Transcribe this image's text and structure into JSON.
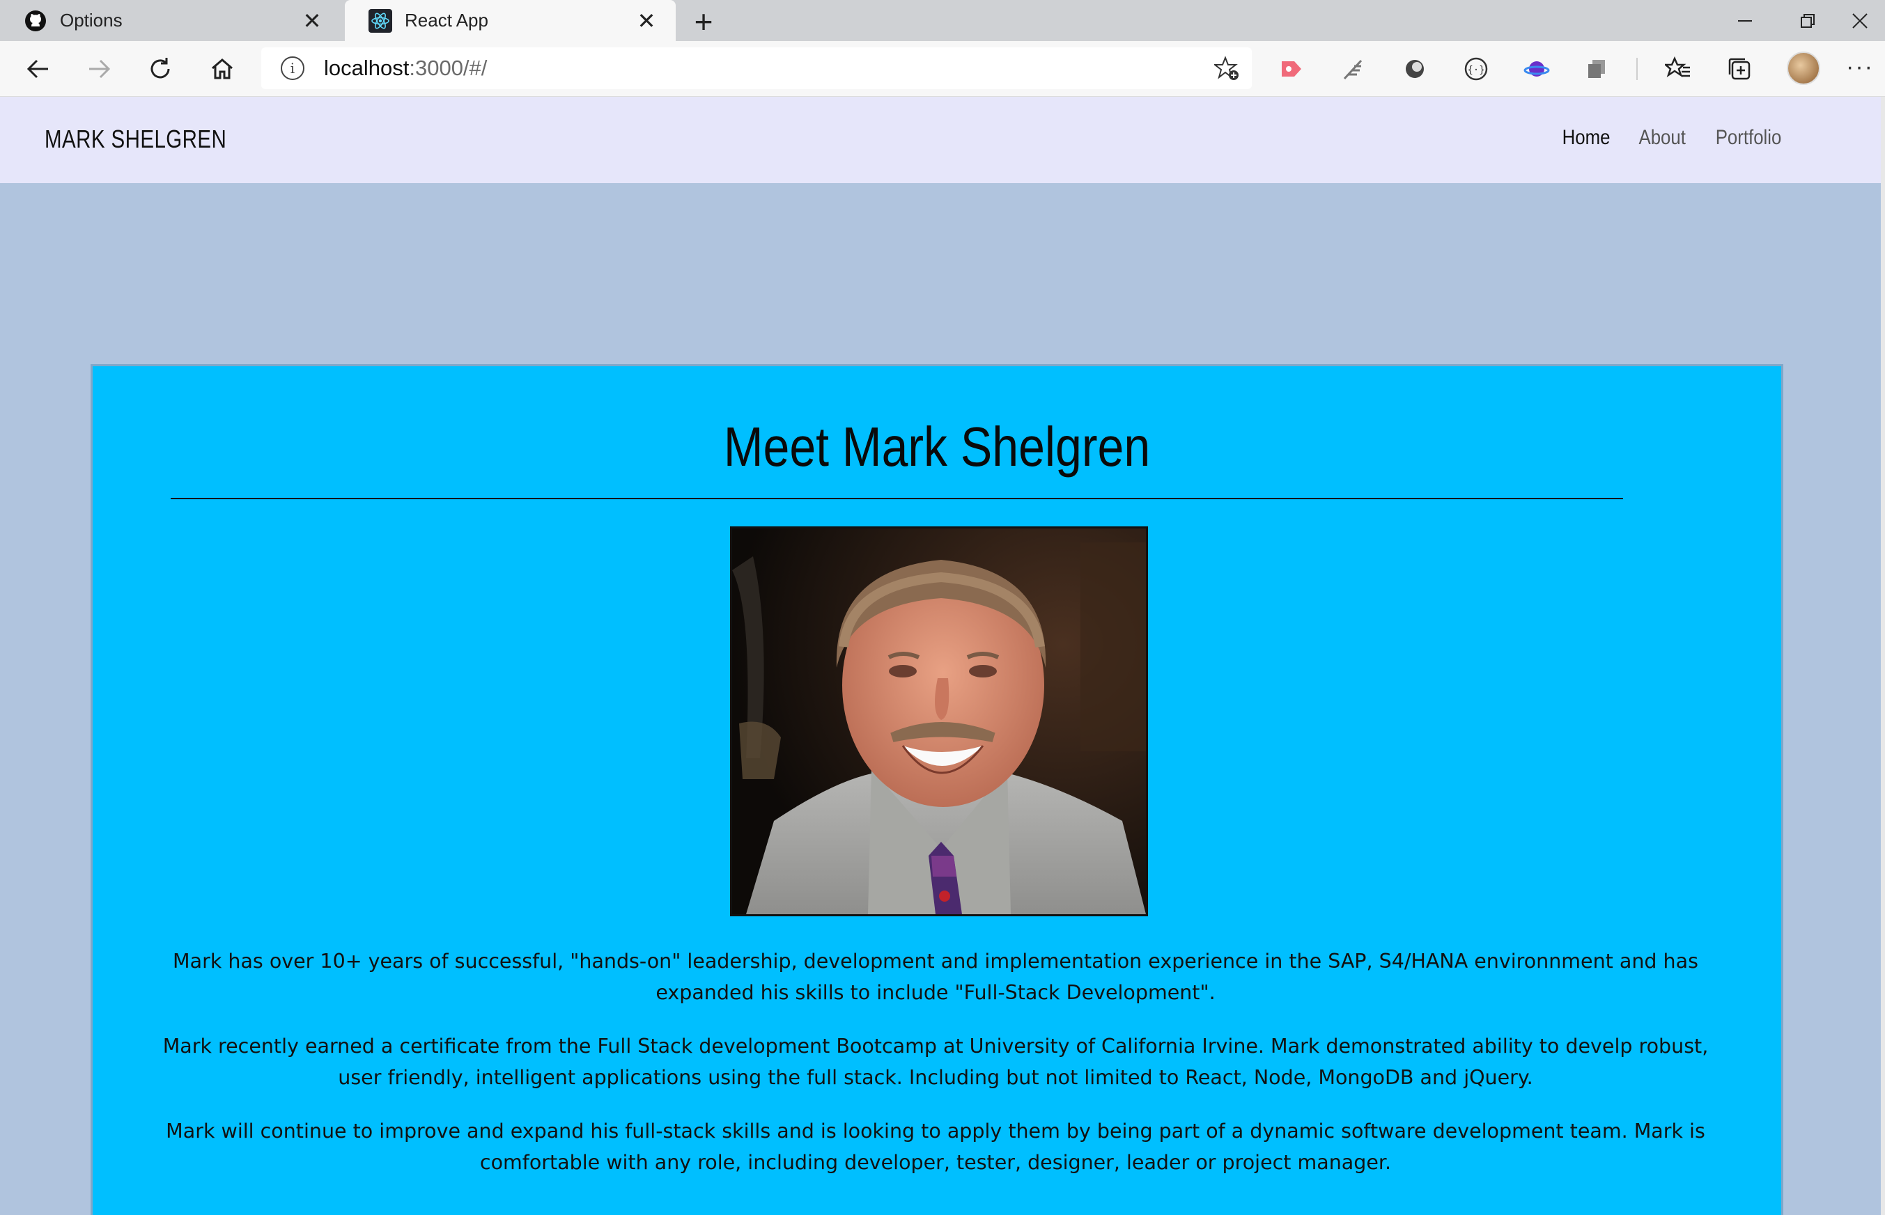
{
  "browser": {
    "tabs": [
      {
        "title": "Options",
        "icon": "github-icon",
        "active": false
      },
      {
        "title": "React App",
        "icon": "react-icon",
        "active": true
      }
    ],
    "address": {
      "host": "localhost",
      "path": ":3000/#/"
    },
    "colors": {
      "tabbar": "#cfd1d4",
      "toolbar": "#f7f7f7"
    }
  },
  "site": {
    "brand": "MARK SHELGREN",
    "nav": [
      {
        "label": "Home",
        "active": true
      },
      {
        "label": "About",
        "active": false
      },
      {
        "label": "Portfolio",
        "active": false
      }
    ],
    "colors": {
      "navbar": "#e6e6fa",
      "page": "#b0c4de",
      "card": "#00bfff"
    }
  },
  "main": {
    "heading": "Meet Mark Shelgren",
    "photo_alt": "portrait-photo",
    "paragraphs": [
      "Mark has over 10+ years of successful, \"hands-on\" leadership, development and implementation experience in the SAP, S4/HANA environnment and has expanded his skills to include \"Full-Stack Development\".",
      "Mark recently earned a certificate from the Full Stack development Bootcamp at University of California Irvine. Mark demonstrated ability to develp robust, user friendly, intelligent applications using the full stack. Including but not limited to React, Node, MongoDB and jQuery.",
      "Mark will continue to improve and expand his full-stack skills and is looking to apply them by being part of a dynamic software development team. Mark is comfortable with any role, including developer, tester, designer, leader or project manager."
    ]
  }
}
